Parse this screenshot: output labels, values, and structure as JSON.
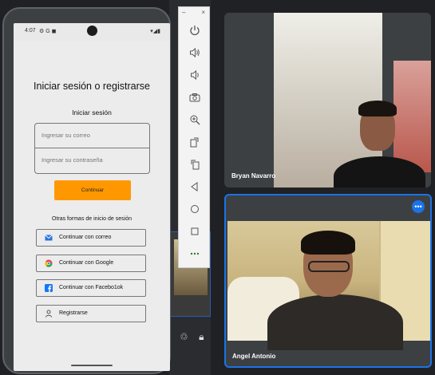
{
  "phone": {
    "status_time": "4:07",
    "status_icons": "⚙ G ◼",
    "status_right": "▾◢▮",
    "title": "Iniciar sesión o registrarse",
    "login_header": "Iniciar sesión",
    "email_placeholder": "Ingresar su correo",
    "password_placeholder": "Ingresar su contraseña",
    "continue_label": "Continuar",
    "other_methods": "Otras formas de inicio de sesión",
    "alt_buttons": [
      {
        "label": "Continuar con correo",
        "icon": "mail-icon"
      },
      {
        "label": "Continuar con Google",
        "icon": "google-icon"
      },
      {
        "label": "Continuar con Facebo1ok",
        "icon": "facebook-icon"
      },
      {
        "label": "Registrarse",
        "icon": "person-icon"
      }
    ]
  },
  "emulator_toolbar": {
    "minimize": "–",
    "close": "×",
    "buttons": [
      "power-icon",
      "volume-up-icon",
      "volume-down-icon",
      "camera-icon",
      "zoom-icon",
      "rotate-left-icon",
      "rotate-right-icon",
      "back-icon",
      "home-icon",
      "overview-icon",
      "more-icon"
    ]
  },
  "meeting": {
    "participants": [
      {
        "name": "Bryan Navarro"
      },
      {
        "name": "Angel Antonio"
      }
    ],
    "more_label": "•••"
  },
  "colors": {
    "accent_orange": "#ff9800",
    "meet_blue": "#1a73e8",
    "background": "#202124"
  }
}
